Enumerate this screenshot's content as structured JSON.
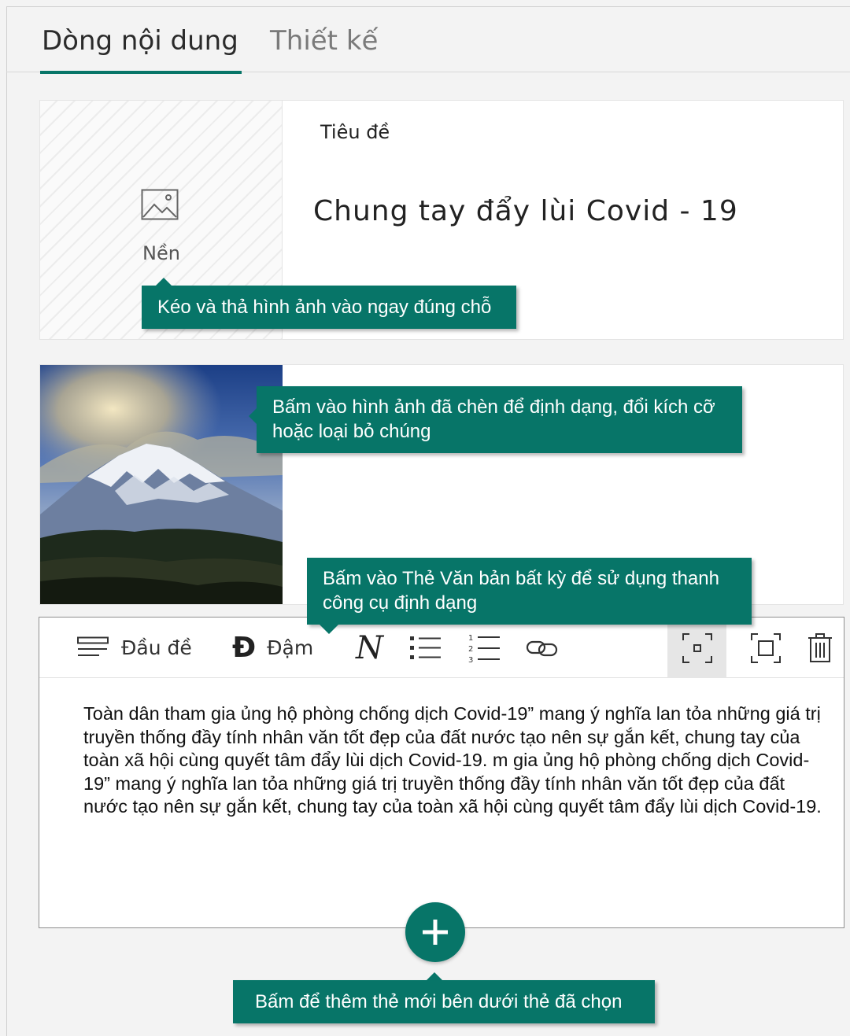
{
  "tabs": {
    "content": "Dòng nội dung",
    "design": "Thiết kế"
  },
  "title_card": {
    "background_label": "Nền",
    "title_label": "Tiêu đề",
    "title_value": "Chung tay đẩy lùi Covid - 19"
  },
  "toolbar": {
    "heading_label": "Đầu đề",
    "bold_glyph": "Đ",
    "bold_label": "Đậm",
    "italic_glyph": "N"
  },
  "text_card": {
    "body": "Toàn dân tham gia ủng hộ phòng chống dịch Covid-19” mang ý nghĩa lan tỏa những giá trị truyền thống đầy tính nhân văn tốt đẹp của đất nước tạo nên sự gắn kết, chung tay của toàn xã hội cùng quyết tâm đẩy lùi dịch Covid-19. m gia ủng hộ phòng chống dịch Covid-19” mang ý nghĩa lan tỏa những giá trị truyền thống đầy tính nhân văn tốt đẹp của đất nước tạo nên sự gắn kết, chung tay của toàn xã hội cùng quyết tâm đẩy lùi dịch Covid-19."
  },
  "callouts": {
    "drag_drop": "Kéo và thả hình ảnh vào ngay đúng chỗ",
    "click_image": "Bấm vào hình ảnh đã chèn để định dạng, đổi kích cỡ hoặc loại bỏ chúng",
    "click_text_card": "Bấm vào Thẻ Văn bản bất kỳ để sử dụng thanh công cụ định dạng",
    "add_card": "Bấm để thêm thẻ mới bên dưới thẻ đã chọn"
  },
  "colors": {
    "accent": "#077568"
  },
  "icons": {
    "background": "image-icon",
    "heading": "heading-lines-icon",
    "bullets": "bulleted-list-icon",
    "numbered": "numbered-list-icon",
    "link": "link-icon",
    "fit": "fit-focus-icon",
    "fill": "fill-frame-icon",
    "delete": "trash-icon",
    "add": "plus-icon"
  }
}
